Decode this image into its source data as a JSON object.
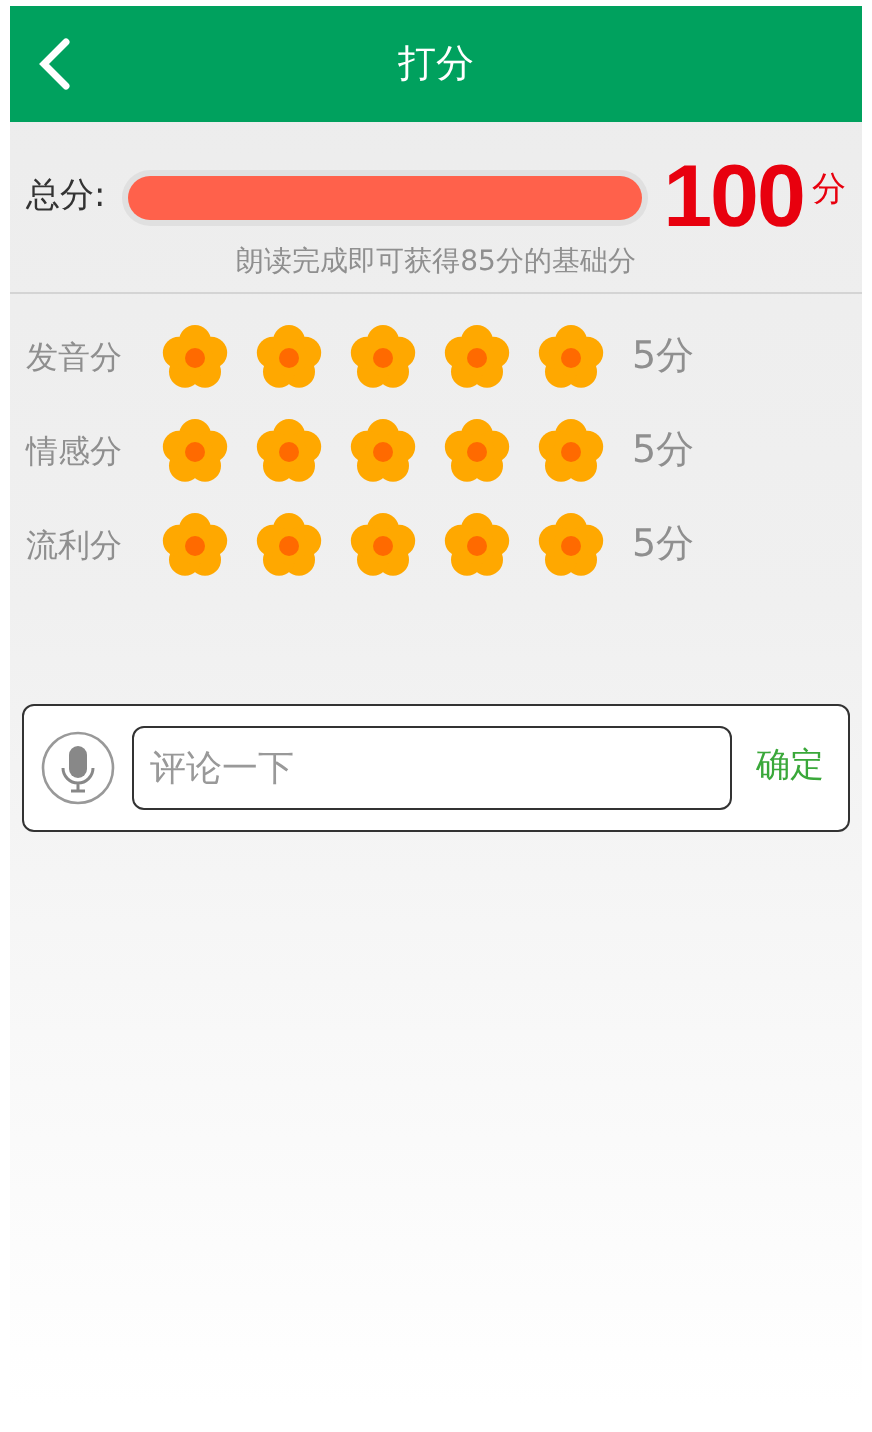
{
  "header": {
    "title": "打分"
  },
  "total": {
    "label": "总分:",
    "level": 1,
    "score": "100",
    "unit": "分",
    "note": "朗读完成即可获得85分的基础分"
  },
  "ratings": [
    {
      "label": "发音分",
      "stars": 5,
      "score": "5分"
    },
    {
      "label": "情感分",
      "stars": 5,
      "score": "5分"
    },
    {
      "label": "流利分",
      "stars": 5,
      "score": "5分"
    }
  ],
  "comment": {
    "placeholder": "评论一下",
    "button": "确定"
  }
}
